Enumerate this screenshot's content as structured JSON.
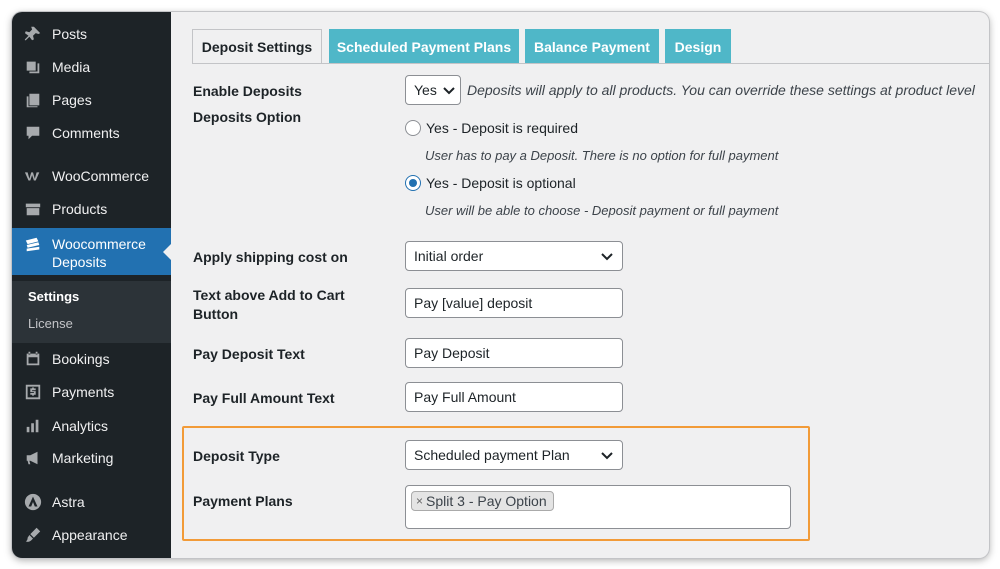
{
  "sidebar": {
    "items": [
      {
        "label": "Posts",
        "icon": "pin-icon"
      },
      {
        "label": "Media",
        "icon": "media-icon"
      },
      {
        "label": "Pages",
        "icon": "pages-icon"
      },
      {
        "label": "Comments",
        "icon": "comments-icon"
      },
      {
        "label": "WooCommerce",
        "icon": "woocommerce-icon"
      },
      {
        "label": "Products",
        "icon": "products-icon"
      },
      {
        "label": "Woocommerce Deposits",
        "icon": "deposits-icon"
      },
      {
        "label": "Bookings",
        "icon": "calendar-icon"
      },
      {
        "label": "Payments",
        "icon": "dollar-icon"
      },
      {
        "label": "Analytics",
        "icon": "bar-chart-icon"
      },
      {
        "label": "Marketing",
        "icon": "megaphone-icon"
      },
      {
        "label": "Astra",
        "icon": "astra-icon"
      },
      {
        "label": "Appearance",
        "icon": "brush-icon"
      }
    ],
    "submenu": [
      "Settings",
      "License"
    ]
  },
  "tabs": [
    "Deposit Settings",
    "Scheduled Payment Plans",
    "Balance Payment",
    "Design"
  ],
  "form": {
    "enable_deposits": {
      "label": "Enable Deposits",
      "value": "Yes",
      "description": "Deposits will apply to all products. You can override these settings at product level"
    },
    "deposits_option": {
      "label": "Deposits Option",
      "options": [
        {
          "label": "Yes - Deposit is required",
          "description": "User has to pay a Deposit. There is no option for full payment",
          "selected": false
        },
        {
          "label": "Yes - Deposit is optional",
          "description": "User will be able to choose - Deposit payment or full payment",
          "selected": true
        }
      ]
    },
    "shipping": {
      "label": "Apply shipping cost on",
      "value": "Initial order"
    },
    "text_above_cart": {
      "label": "Text above Add to Cart Button",
      "value": "Pay [value] deposit"
    },
    "pay_deposit_text": {
      "label": "Pay Deposit Text",
      "value": "Pay Deposit"
    },
    "pay_full_text": {
      "label": "Pay Full Amount Text",
      "value": "Pay Full Amount"
    },
    "deposit_type": {
      "label": "Deposit Type",
      "value": "Scheduled payment Plan"
    },
    "payment_plans": {
      "label": "Payment Plans",
      "chip": "Split 3 - Pay Option",
      "chip_remove": "×"
    }
  },
  "colors": {
    "sidebar_bg": "#1d2327",
    "active": "#2271b1",
    "tab_accent": "#4fb7c8",
    "highlight": "#f29b38"
  }
}
